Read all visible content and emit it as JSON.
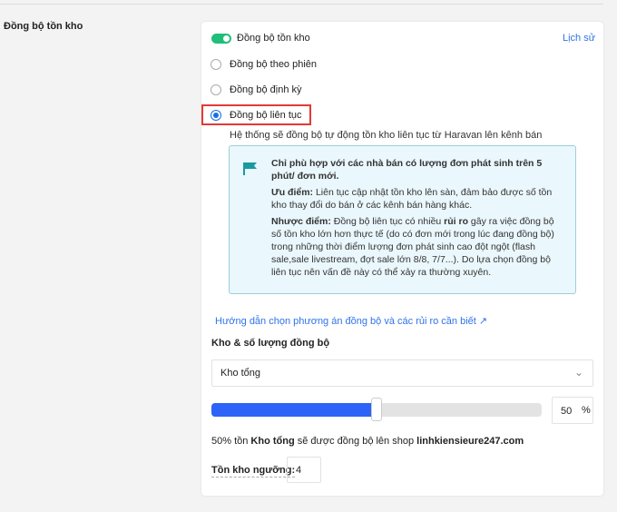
{
  "section_label": "Đồng bộ tồn kho",
  "toggle": {
    "label": "Đồng bộ tồn kho",
    "on": true
  },
  "history_link": "Lịch sử",
  "options": [
    {
      "label": "Đồng bộ theo phiên",
      "selected": false
    },
    {
      "label": "Đồng bộ định kỳ",
      "selected": false
    },
    {
      "label": "Đồng bộ liên tục",
      "selected": true
    }
  ],
  "description": "Hệ thống sẽ đồng bộ tự động tồn kho liên tục từ Haravan lên kênh bán",
  "info": {
    "icon": "flag-icon",
    "title": "Chỉ phù hợp với các nhà bán có lượng đơn phát sinh trên 5 phút/ đơn mới.",
    "pros_label": "Ưu điểm:",
    "pros": " Liên tục cập nhật tồn kho lên sàn, đảm bảo được số tồn kho thay đổi do bán ở các kênh bán hàng khác.",
    "cons_label": "Nhược điểm:",
    "cons_1": " Đồng bộ liên tục có nhiều ",
    "cons_bold": "rủi ro",
    "cons_2": " gây ra việc đồng bộ số tồn kho lớn hơn thực tế (do có đơn mới trong lúc đang đồng bộ) trong những thời điểm lượng đơn phát sinh cao đột ngột (flash sale,sale livestream, đợt sale lớn 8/8, 7/7...). Do lựa chọn đồng bộ liên tục nên vấn đề này có thể xảy ra thường xuyên."
  },
  "guide_link": "Hướng dẫn chọn phương án đồng bộ và các rủi ro cần biết",
  "warehouse_heading": "Kho & số lượng đồng bộ",
  "warehouse_select": "Kho tổng",
  "slider_percent": 50,
  "percent_value": "50",
  "percent_unit": "%",
  "summary": {
    "p1": "50% tồn ",
    "warehouse": "Kho tổng",
    "p2": " sẽ được đồng bộ lên shop ",
    "shop": "linhkiensieure247.com"
  },
  "threshold_label": "Tồn kho ngưỡng:",
  "threshold_value": "4",
  "colors": {
    "accent": "#2d63f6",
    "toggle": "#1fbf7a",
    "highlight": "#e53935"
  }
}
